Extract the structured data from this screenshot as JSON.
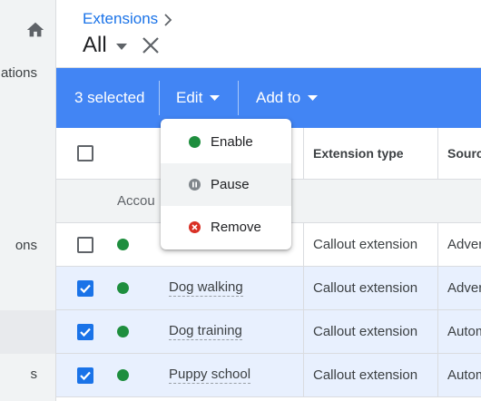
{
  "sidebar": {
    "items": [
      {
        "label": "ations"
      },
      {
        "label": "ons"
      },
      {
        "label": "s"
      }
    ]
  },
  "header": {
    "breadcrumb": "Extensions",
    "title": "All"
  },
  "action_bar": {
    "selected_text": "3 selected",
    "edit_label": "Edit",
    "add_to_label": "Add to"
  },
  "edit_menu": {
    "items": [
      {
        "label": "Enable",
        "icon": "enable-icon",
        "color": "#1e8e3e"
      },
      {
        "label": "Pause",
        "icon": "pause-icon",
        "color": "#80868b"
      },
      {
        "label": "Remove",
        "icon": "remove-icon",
        "color": "#d93025"
      }
    ]
  },
  "table": {
    "columns": {
      "extension_type": "Extension type",
      "source": "Sourc"
    },
    "group_label": "Accou",
    "rows": [
      {
        "selected": false,
        "name": "",
        "type": "Callout extension",
        "source": "Adver"
      },
      {
        "selected": true,
        "name": "Dog walking",
        "type": "Callout extension",
        "source": "Adver"
      },
      {
        "selected": true,
        "name": "Dog training",
        "type": "Callout extension",
        "source": "Autom"
      },
      {
        "selected": true,
        "name": "Puppy school",
        "type": "Callout extension",
        "source": "Autom"
      }
    ]
  },
  "colors": {
    "accent": "#1a73e8",
    "action_bar": "#4285f4",
    "status_enabled": "#1e8e3e",
    "selected_row": "#e8f0fe"
  }
}
